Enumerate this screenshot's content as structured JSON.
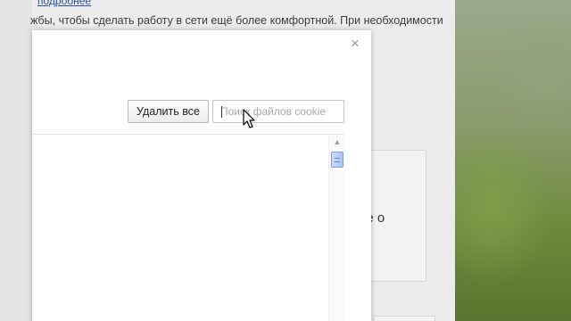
{
  "background": {
    "link_text": "подробнее",
    "description": "жбы, чтобы сделать работу в сети ещё более комфортной. При необходимости",
    "panel_text": "ее о"
  },
  "dialog": {
    "close_label": "×",
    "delete_all_label": "Удалить все",
    "search": {
      "value": "",
      "placeholder": "Поиск файлов cookie"
    },
    "scroll_up_glyph": "▲"
  },
  "colors": {
    "link": "#2a4fb0",
    "scroll_thumb": "#a9c3f3",
    "dialog_bg": "#ffffff"
  },
  "icons": [
    "close-icon",
    "scroll-up-arrow-icon",
    "mouse-cursor-icon"
  ]
}
